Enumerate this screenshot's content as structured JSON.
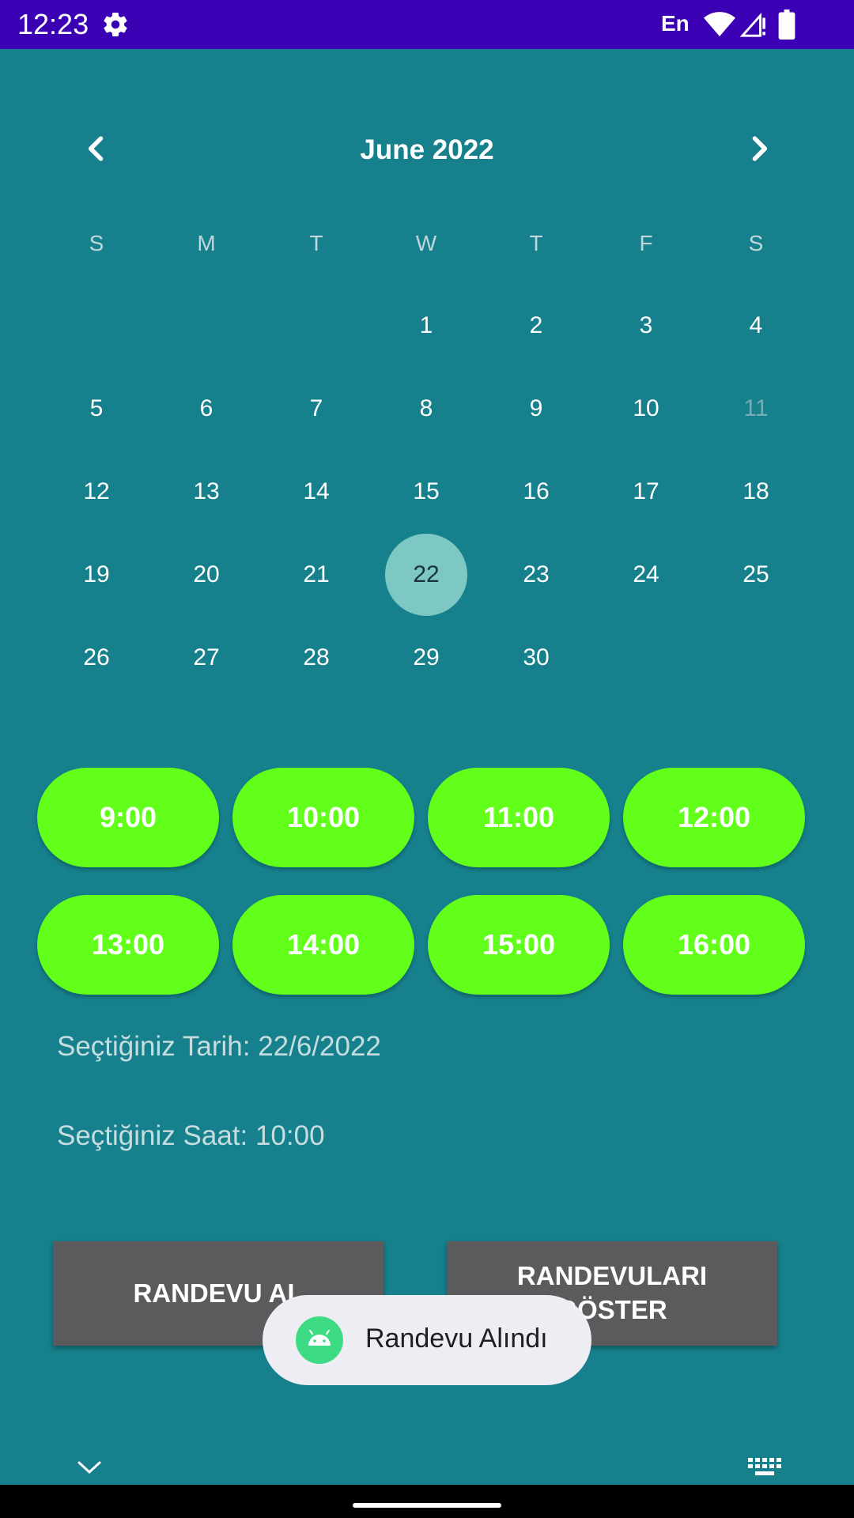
{
  "status_bar": {
    "time": "12:23",
    "language": "En",
    "icons": [
      "gear-icon",
      "wifi-icon",
      "signal-icon",
      "battery-icon"
    ],
    "background": "#3B00B4"
  },
  "calendar": {
    "month_title": "June 2022",
    "weekdays": [
      "S",
      "M",
      "T",
      "W",
      "T",
      "F",
      "S"
    ],
    "weeks": [
      [
        "",
        "",
        "",
        "1",
        "2",
        "3",
        "4"
      ],
      [
        "5",
        "6",
        "7",
        "8",
        "9",
        "10",
        "11"
      ],
      [
        "12",
        "13",
        "14",
        "15",
        "16",
        "17",
        "18"
      ],
      [
        "19",
        "20",
        "21",
        "22",
        "23",
        "24",
        "25"
      ],
      [
        "26",
        "27",
        "28",
        "29",
        "30",
        "",
        ""
      ]
    ],
    "selected_day": "22",
    "disabled_days": [
      "11"
    ]
  },
  "time_slots": [
    "9:00",
    "10:00",
    "11:00",
    "12:00",
    "13:00",
    "14:00",
    "15:00",
    "16:00"
  ],
  "selection": {
    "date_text": "Seçtiğiniz Tarih: 22/6/2022",
    "time_text": "Seçtiğiniz Saat: 10:00"
  },
  "buttons": {
    "book_label": "RANDEVU AL",
    "show_label": "RANDEVULARI GÖSTER"
  },
  "toast": {
    "message": "Randevu Alındı",
    "icon": "android-icon"
  },
  "colors": {
    "background": "#16808C",
    "time_slot": "#61FF1A",
    "action_button": "#5B5B5D",
    "selected_day": "#7DC8C2"
  }
}
